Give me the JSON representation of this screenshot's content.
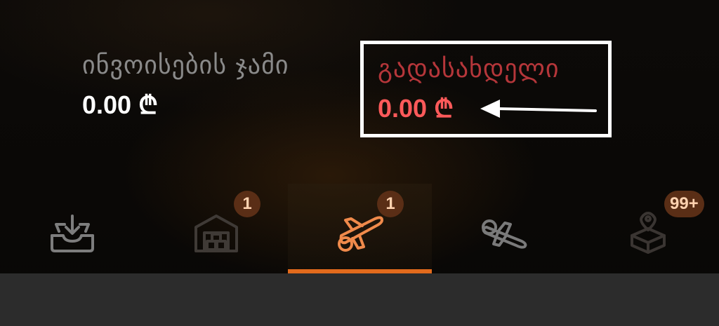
{
  "summary": {
    "invoices_total": {
      "label": "ინვოისების ჯამი",
      "value": "0.00 ₾"
    },
    "payable": {
      "label": "გადასახდელი",
      "value": "0.00 ₾"
    }
  },
  "tabs": [
    {
      "icon": "inbox-download-icon",
      "badge": ""
    },
    {
      "icon": "warehouse-icon",
      "badge": "1"
    },
    {
      "icon": "airplane-icon",
      "badge": "1",
      "active": true
    },
    {
      "icon": "airplane-landing-icon",
      "badge": ""
    },
    {
      "icon": "package-location-icon",
      "badge": "99+"
    }
  ],
  "colors": {
    "accent": "#e26a1c",
    "payable_label": "#b5363a",
    "payable_value": "#ff5a5a",
    "badge_bg": "#5a2e16"
  }
}
